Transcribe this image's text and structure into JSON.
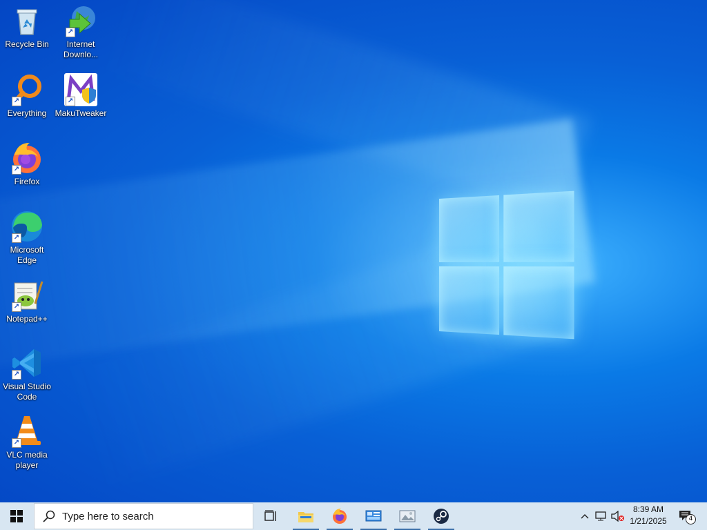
{
  "desktop_icons": [
    {
      "label": "Recycle Bin",
      "icon": "recycle-bin-icon"
    },
    {
      "label": "Internet Downlo...",
      "icon": "internet-download-manager-icon"
    },
    {
      "label": "Everything",
      "icon": "everything-search-icon"
    },
    {
      "label": "MakuTweaker",
      "icon": "makutweaker-icon"
    },
    {
      "label": "Firefox",
      "icon": "firefox-icon"
    },
    {
      "label": "Microsoft Edge",
      "icon": "microsoft-edge-icon"
    },
    {
      "label": "Notepad++",
      "icon": "notepad-plus-plus-icon"
    },
    {
      "label": "Visual Studio Code",
      "icon": "vscode-icon"
    },
    {
      "label": "VLC media player",
      "icon": "vlc-icon"
    }
  ],
  "taskbar": {
    "search_placeholder": "Type here to search",
    "pinned": [
      {
        "name": "task-view",
        "icon": "task-view-icon"
      },
      {
        "name": "file-explorer",
        "icon": "folder-icon"
      },
      {
        "name": "firefox",
        "icon": "firefox-icon"
      },
      {
        "name": "control-panel",
        "icon": "control-panel-icon"
      },
      {
        "name": "image-viewer",
        "icon": "image-viewer-icon"
      },
      {
        "name": "steam",
        "icon": "steam-icon"
      }
    ],
    "tray": {
      "clock_time": "8:39 AM",
      "clock_date": "1/21/2025",
      "notification_count": "4"
    }
  },
  "colors": {
    "taskbar_bg": "#d8e6f2",
    "desktop_accent": "#0a7ae6"
  }
}
